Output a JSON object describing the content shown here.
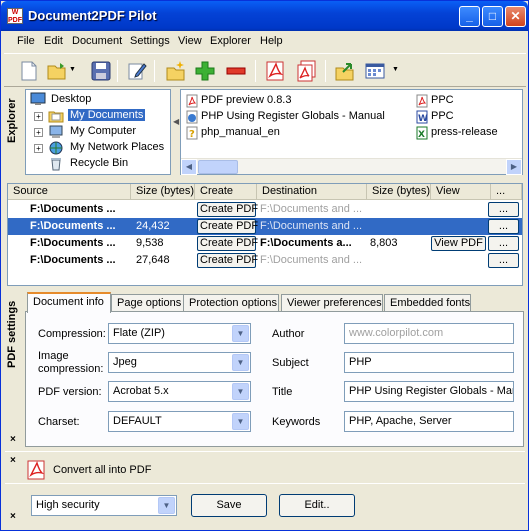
{
  "window": {
    "title": "Document2PDF Pilot"
  },
  "menu": [
    "File",
    "Edit",
    "Document",
    "Settings",
    "View",
    "Explorer",
    "Help"
  ],
  "toolbar_icons": [
    "new-document-icon",
    "open-folder-icon",
    "save-icon",
    "edit-icon",
    "new-folder-icon",
    "add-icon",
    "remove-icon",
    "convert-pdf-icon",
    "convert-all-pdf-icon",
    "export-icon",
    "view-mode-icon"
  ],
  "explorer": {
    "label": "Explorer",
    "tree": [
      {
        "label": "Desktop"
      },
      {
        "label": "My Documents"
      },
      {
        "label": "My Computer"
      },
      {
        "label": "My Network Places"
      },
      {
        "label": "Recycle Bin"
      }
    ],
    "files_col1": [
      "PDF preview 0.8.3",
      "PHP Using Register Globals - Manual",
      "php_manual_en"
    ],
    "files_col2": [
      "PPC",
      "PPC",
      "press-release"
    ]
  },
  "grid": {
    "headers": {
      "source": "Source",
      "size1": "Size (bytes)",
      "create": "Create",
      "destination": "Destination",
      "size2": "Size (bytes)",
      "view": "View",
      "more": "..."
    },
    "create_label": "Create PDF",
    "view_label": "View PDF",
    "more_label": "...",
    "rows": [
      {
        "source": "F:\\Documents ...",
        "size1": "",
        "destination": "F:\\Documents and ...",
        "size2": ""
      },
      {
        "source": "F:\\Documents ...",
        "size1": "24,432",
        "destination": "F:\\Documents and ...",
        "size2": ""
      },
      {
        "source": "F:\\Documents ...",
        "size1": "9,538",
        "destination": "F:\\Documents a...",
        "size2": "8,803"
      },
      {
        "source": "F:\\Documents ...",
        "size1": "27,648",
        "destination": "F:\\Documents and ...",
        "size2": ""
      }
    ]
  },
  "pdf_settings": {
    "label": "PDF settings",
    "tabs": [
      "Document info",
      "Page options",
      "Protection options",
      "Viewer preferences",
      "Embedded fonts"
    ],
    "compression": {
      "label": "Compression:",
      "value": "Flate (ZIP)"
    },
    "image_compression": {
      "label": "Image compression:",
      "value": "Jpeg"
    },
    "pdf_version": {
      "label": "PDF version:",
      "value": "Acrobat 5.x"
    },
    "charset": {
      "label": "Charset:",
      "value": "DEFAULT"
    },
    "author": {
      "label": "Author",
      "placeholder": "www.colorpilot.com"
    },
    "subject": {
      "label": "Subject",
      "value": "PHP"
    },
    "title": {
      "label": "Title",
      "value": "PHP Using Register Globals - Man"
    },
    "keywords": {
      "label": "Keywords",
      "value": "PHP, Apache, Server"
    }
  },
  "convert_all_label": "Convert all into PDF",
  "bottom": {
    "security": "High security",
    "save_label": "Save",
    "edit_label": "Edit.."
  },
  "close_glyph": "×"
}
